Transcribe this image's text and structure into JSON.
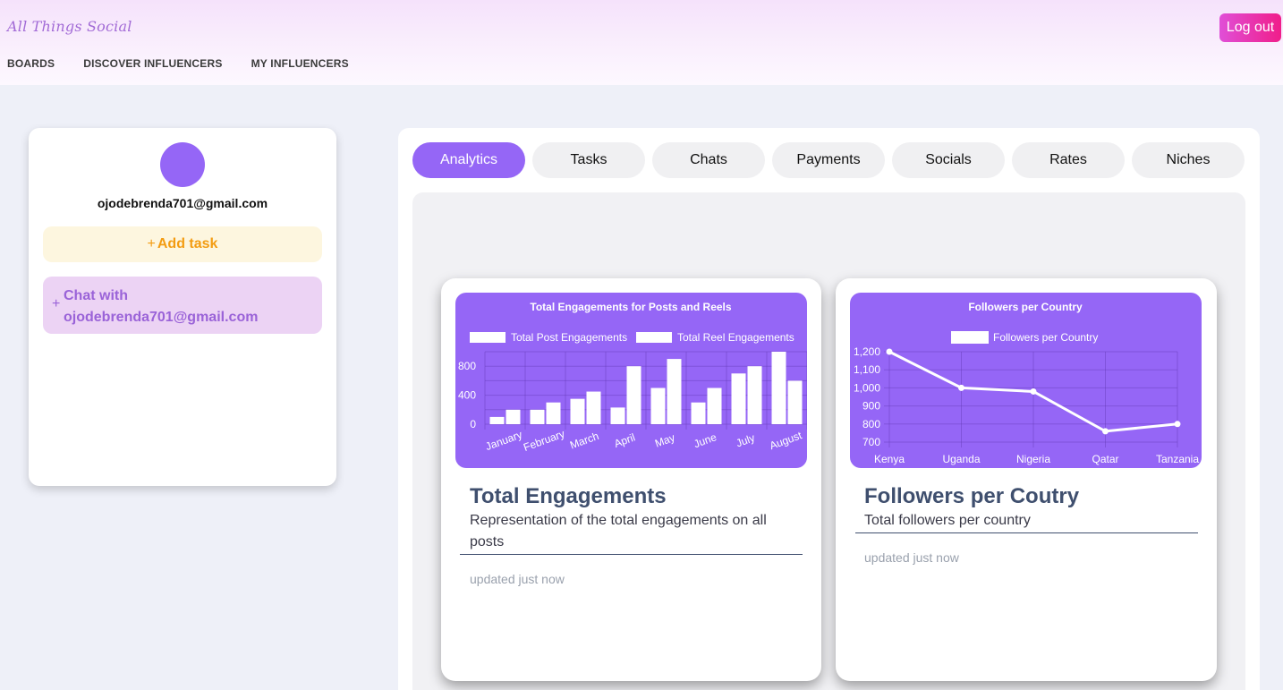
{
  "header": {
    "brand": "All Things Social",
    "logout_label": "Log out",
    "nav": [
      "BOARDS",
      "DISCOVER INFLUENCERS",
      "MY INFLUENCERS"
    ]
  },
  "profile": {
    "email": "ojodebrenda701@gmail.com",
    "add_task_label": "Add task",
    "chat_label_line1": "Chat with",
    "chat_label_line2": "ojodebrenda701@gmail.com",
    "plus": "+"
  },
  "tabs": [
    "Analytics",
    "Tasks",
    "Chats",
    "Payments",
    "Socials",
    "Rates",
    "Niches"
  ],
  "active_tab": "Analytics",
  "colors": {
    "accent": "#9566f6",
    "logout_start": "#e04fd7",
    "logout_end": "#f01e8a",
    "add_task": "#f39c12"
  },
  "cards": [
    {
      "title": "Total Engagements",
      "subtitle_line1": "Representation of the total engagements on all",
      "subtitle_line2": "posts",
      "updated": "updated just now"
    },
    {
      "title": "Followers per Coutry",
      "subtitle": "Total followers per country",
      "updated": "updated just now"
    }
  ],
  "chart_data": [
    {
      "type": "bar",
      "title": "Total Engagements for Posts and Reels",
      "categories": [
        "January",
        "February",
        "March",
        "April",
        "May",
        "June",
        "July",
        "August"
      ],
      "series": [
        {
          "name": "Total Post Engagements",
          "values": [
            100,
            200,
            350,
            230,
            500,
            300,
            700,
            1000
          ]
        },
        {
          "name": "Total Reel Engagements",
          "values": [
            200,
            300,
            450,
            800,
            900,
            500,
            800,
            600
          ]
        }
      ],
      "yticks": [
        "0",
        "400",
        "800"
      ],
      "ylim": [
        0,
        1000
      ],
      "legend": "top",
      "grid": true
    },
    {
      "type": "line",
      "title": "Followers per Country",
      "categories": [
        "Kenya",
        "Uganda",
        "Nigeria",
        "Qatar",
        "Tanzania"
      ],
      "series": [
        {
          "name": "Followers per Country",
          "values": [
            1200,
            1000,
            980,
            760,
            800
          ]
        }
      ],
      "yticks": [
        "700",
        "800",
        "900",
        "1,000",
        "1,100",
        "1,200"
      ],
      "ylim": [
        700,
        1200
      ],
      "legend": "top",
      "grid": true
    }
  ]
}
